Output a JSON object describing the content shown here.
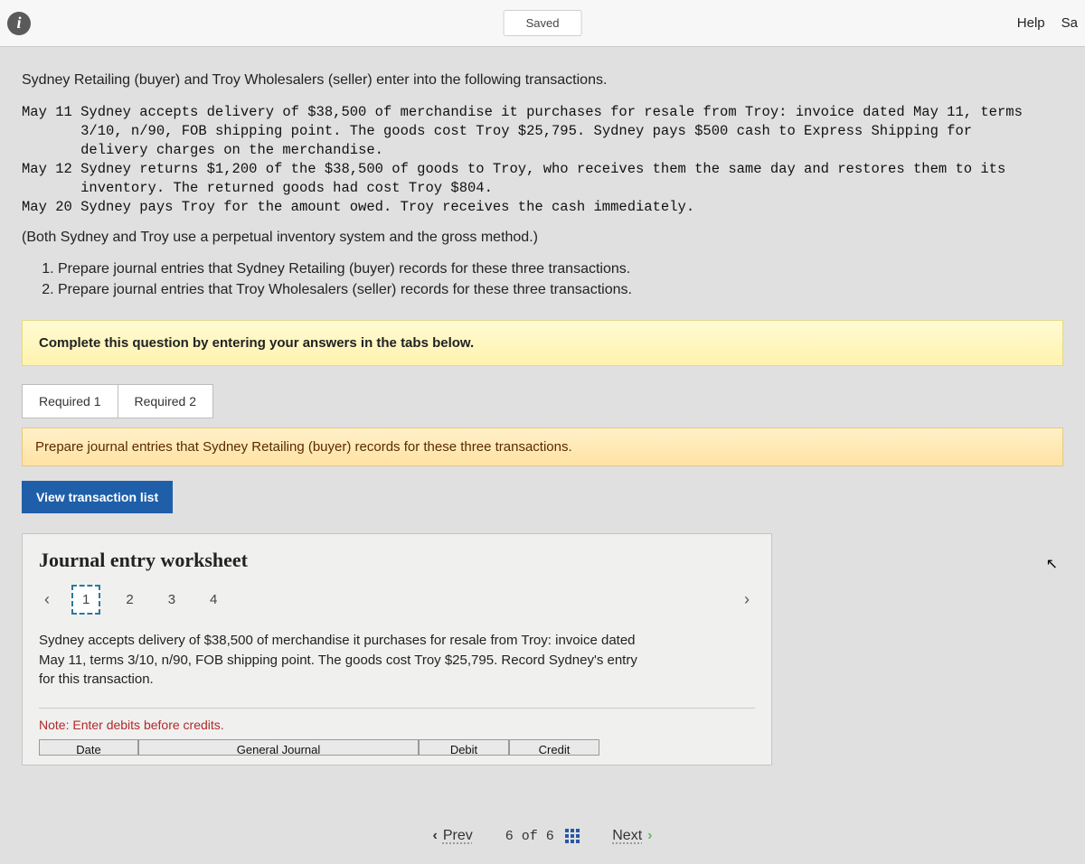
{
  "topbar": {
    "saved": "Saved",
    "help": "Help",
    "right_cut": "Sa"
  },
  "question": {
    "intro": "Sydney Retailing (buyer) and Troy Wholesalers (seller) enter into the following transactions.",
    "events": "May 11 Sydney accepts delivery of $38,500 of merchandise it purchases for resale from Troy: invoice dated May 11, terms\n       3/10, n/90, FOB shipping point. The goods cost Troy $25,795. Sydney pays $500 cash to Express Shipping for\n       delivery charges on the merchandise.\nMay 12 Sydney returns $1,200 of the $38,500 of goods to Troy, who receives them the same day and restores them to its\n       inventory. The returned goods had cost Troy $804.\nMay 20 Sydney pays Troy for the amount owed. Troy receives the cash immediately.",
    "method": "(Both Sydney and Troy use a perpetual inventory system and the gross method.)",
    "tasks": [
      "Prepare journal entries that Sydney Retailing (buyer) records for these three transactions.",
      "Prepare journal entries that Troy Wholesalers (seller) records for these three transactions."
    ],
    "instruction_bar": "Complete this question by entering your answers in the tabs below."
  },
  "tabs": {
    "r1": "Required 1",
    "r2": "Required 2"
  },
  "sub_instruction": "Prepare journal entries that Sydney Retailing (buyer) records for these three transactions.",
  "view_btn": "View transaction list",
  "worksheet": {
    "title": "Journal entry worksheet",
    "pages": [
      "1",
      "2",
      "3",
      "4"
    ],
    "desc": "Sydney accepts delivery of $38,500 of merchandise it purchases for resale from Troy: invoice dated May 11, terms 3/10, n/90, FOB shipping point. The goods cost Troy $25,795. Record Sydney's entry for this transaction.",
    "note": "Note: Enter debits before credits.",
    "headers": {
      "date": "Date",
      "gj": "General Journal",
      "debit": "Debit",
      "credit": "Credit"
    }
  },
  "bottomnav": {
    "prev": "Prev",
    "counter": "6 of 6",
    "next": "Next"
  }
}
